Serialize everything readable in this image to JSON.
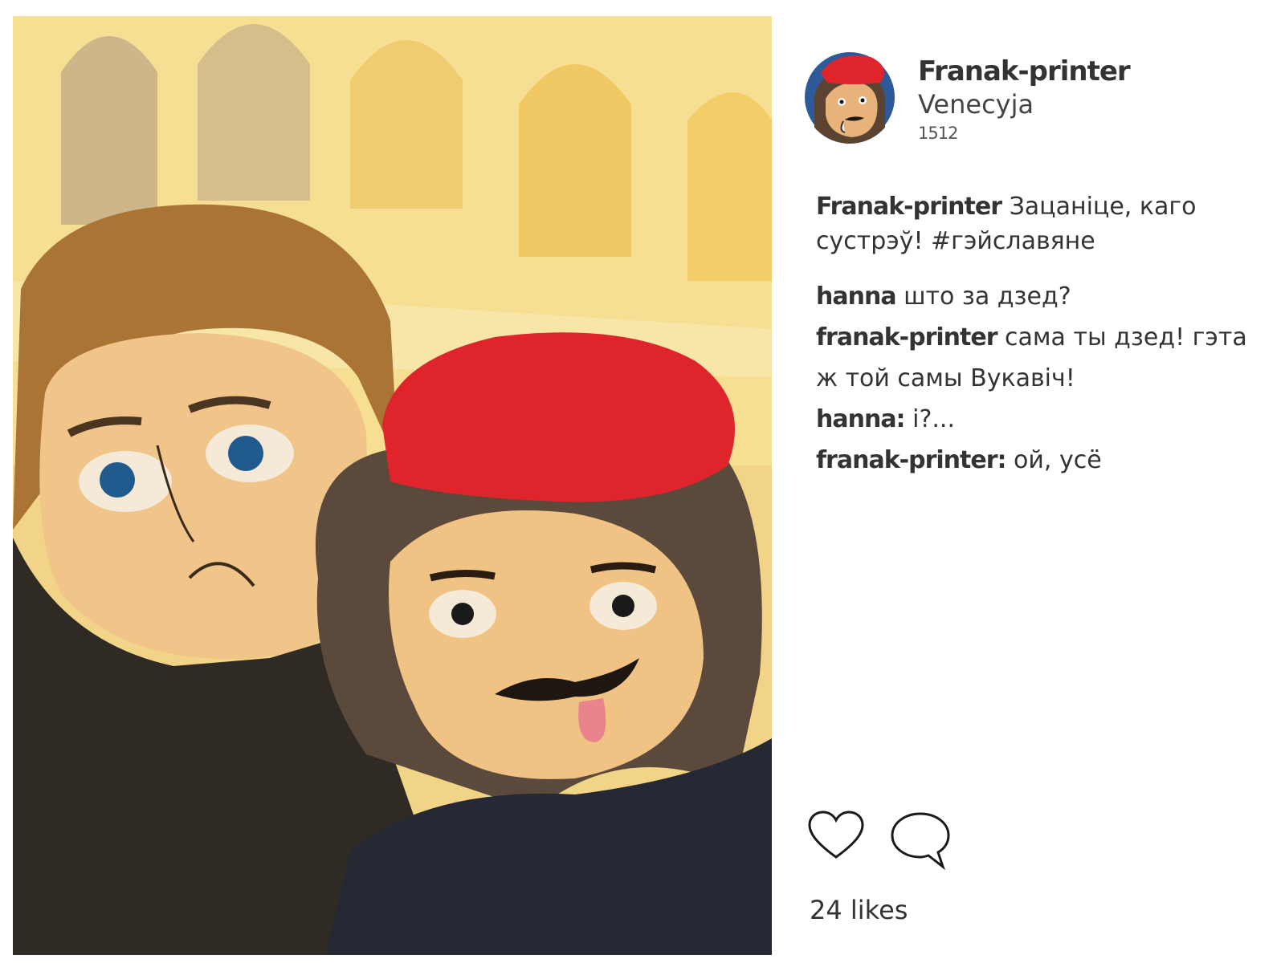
{
  "post": {
    "username": "Franak-printer",
    "location": "Venecyja",
    "year": "1512"
  },
  "caption": {
    "author": "Franak-printer",
    "text": "Зацаніце, каго сустрэў! #гэйславяне"
  },
  "comments": [
    {
      "author": "hanna",
      "text": "што за дзед?"
    },
    {
      "author": "franak-printer",
      "text": "сама ты дзед! гэта ж той самы Вукавіч!"
    },
    {
      "author": "hanna:",
      "text": "і?..."
    },
    {
      "author": "franak-printer:",
      "text": "ой, усё"
    }
  ],
  "actions": {
    "like_icon": "heart-icon",
    "comment_icon": "speech-bubble-icon"
  },
  "likes_text": "24 likes",
  "colors": {
    "beret": "#e0242c",
    "background_yellow": "#f3d77f",
    "text": "#2a2a2a"
  }
}
